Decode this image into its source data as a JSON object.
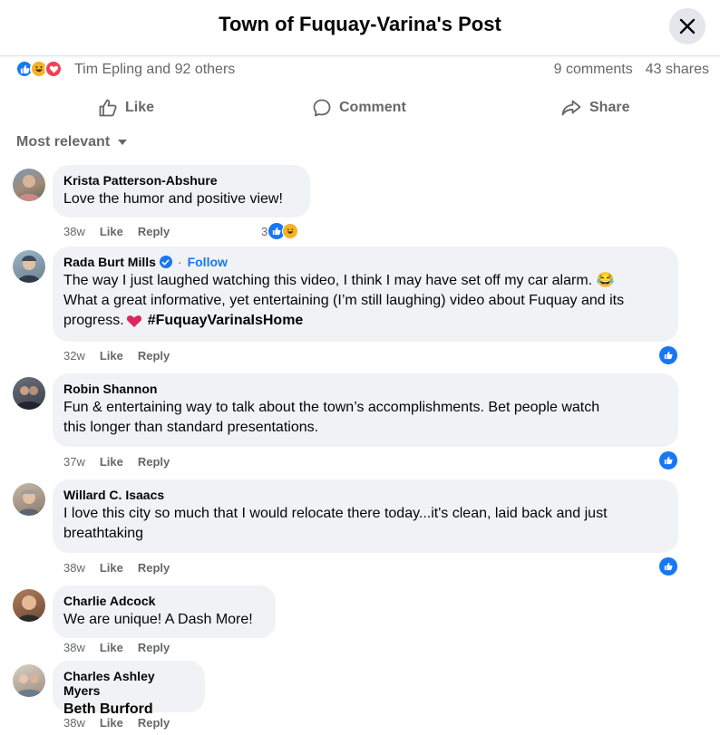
{
  "header": {
    "title": "Town of Fuquay-Varina's Post"
  },
  "stats": {
    "reactions": [
      "like-reaction-icon",
      "haha-reaction-icon",
      "love-reaction-icon"
    ],
    "names": "Tim Epling and 92 others",
    "comments": "9 comments",
    "shares": "43 shares"
  },
  "actions": {
    "like": "Like",
    "comment": "Comment",
    "share": "Share"
  },
  "sort": {
    "label": "Most relevant"
  },
  "comments": [
    {
      "author": "Krista Patterson-Abshure",
      "lines": [
        "Love the humor and positive view!"
      ],
      "time": "38w",
      "like": "Like",
      "reply": "Reply",
      "reaction_count": "3"
    },
    {
      "author": "Rada Burt Mills",
      "follow": "Follow",
      "lines": [
        "The way I just laughed watching this video, I think I may have set off my car alarm. 😂",
        "What a great informative, yet entertaining (I’m still laughing) video about Fuquay and its",
        "progress. "
      ],
      "hashtag": "#FuquayVarinaIsHome",
      "time": "32w",
      "like": "Like",
      "reply": "Reply"
    },
    {
      "author": "Robin Shannon",
      "lines": [
        "Fun & entertaining way to talk about the town’s accomplishments. Bet people watch",
        "this longer than standard presentations."
      ],
      "time": "37w",
      "like": "Like",
      "reply": "Reply"
    },
    {
      "author": "Willard C. Isaacs",
      "lines": [
        "I love this city so much that I would relocate there today...it's clean, laid back and just",
        "breathtaking"
      ],
      "time": "38w",
      "like": "Like",
      "reply": "Reply"
    },
    {
      "author": "Charlie Adcock",
      "lines": [
        "We are unique! A Dash More!"
      ],
      "time": "38w",
      "like": "Like",
      "reply": "Reply"
    },
    {
      "author": "Charles Ashley Myers",
      "lines": [
        "Beth Burford"
      ],
      "time": "38w",
      "like": "Like",
      "reply": "Reply"
    }
  ],
  "colors": {
    "accent": "#1877f2",
    "bubble": "#f0f2f5",
    "secondary_text": "#65676b",
    "love": "#f33e58",
    "haha": "#f7b125"
  }
}
